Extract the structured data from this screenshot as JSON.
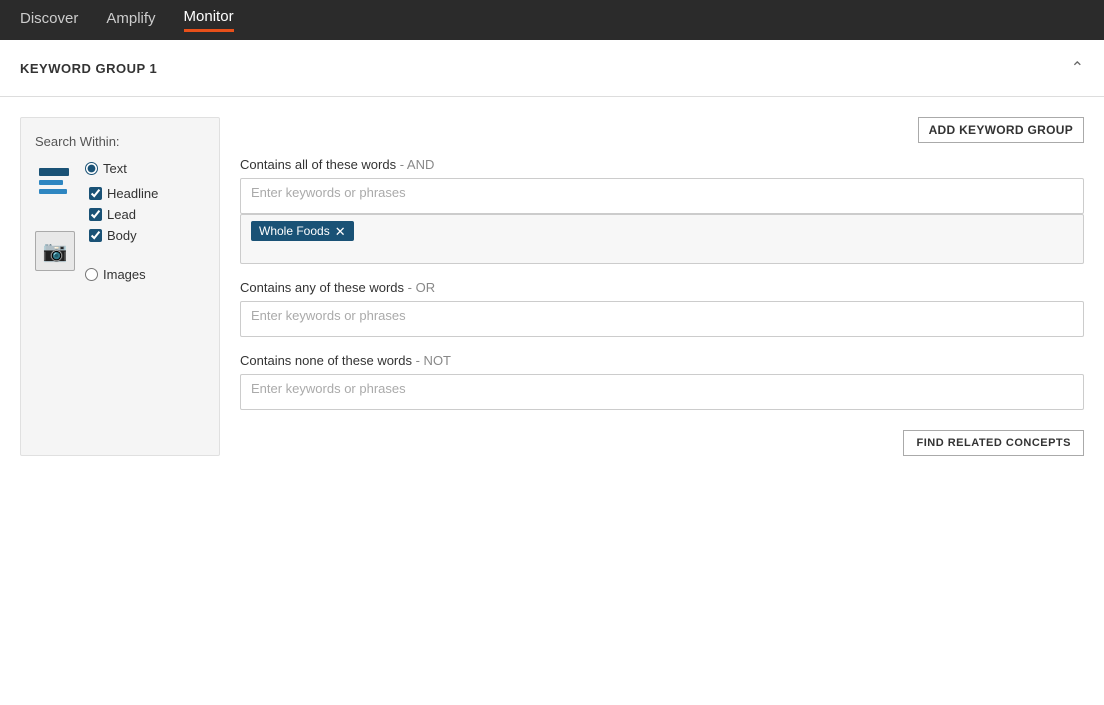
{
  "nav": {
    "items": [
      {
        "id": "discover",
        "label": "Discover",
        "active": false
      },
      {
        "id": "amplify",
        "label": "Amplify",
        "active": false
      },
      {
        "id": "monitor",
        "label": "Monitor",
        "active": true
      }
    ]
  },
  "keywordGroup": {
    "title": "KEYWORD GROUP 1",
    "addGroupBtn": "ADD KEYWORD GROUP",
    "searchWithin": {
      "label": "Search Within:",
      "textOption": "Text",
      "textChecked": true,
      "subOptions": [
        {
          "id": "headline",
          "label": "Headline",
          "checked": true
        },
        {
          "id": "lead",
          "label": "Lead",
          "checked": true
        },
        {
          "id": "body",
          "label": "Body",
          "checked": true
        }
      ],
      "imagesOption": "Images",
      "imagesChecked": false
    },
    "sections": [
      {
        "id": "and",
        "label": "Contains all of these words",
        "qualifier": " - AND",
        "placeholder": "Enter keywords or phrases",
        "tags": [
          "Whole Foods"
        ]
      },
      {
        "id": "or",
        "label": "Contains any of these words",
        "qualifier": " - OR",
        "placeholder": "Enter keywords or phrases",
        "tags": []
      },
      {
        "id": "not",
        "label": "Contains none of these words",
        "qualifier": " - NOT",
        "placeholder": "Enter keywords or phrases",
        "tags": []
      }
    ],
    "findRelatedBtn": "FIND RELATED CONCEPTS"
  }
}
